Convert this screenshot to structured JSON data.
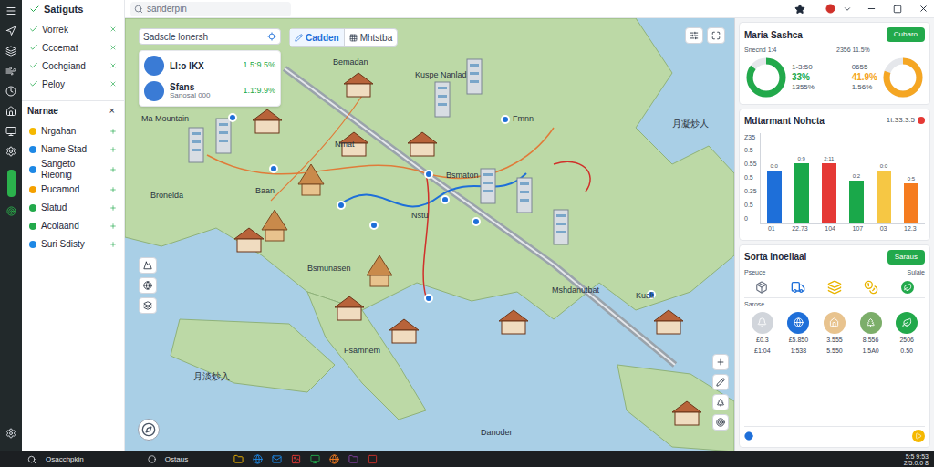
{
  "window": {
    "title": "Satiguts"
  },
  "search": {
    "placeholder": "sanderpin"
  },
  "sidebar": {
    "items": [
      {
        "label": "Vorrek"
      },
      {
        "label": "Cccemat"
      },
      {
        "label": "Cochgiand"
      },
      {
        "label": "Peloy"
      }
    ],
    "section": {
      "title": "Narnae",
      "close": "×",
      "items": [
        {
          "label": "Nrgahan",
          "color": "#f5b800"
        },
        {
          "label": "Name Stad",
          "color": "#1e88e5"
        },
        {
          "label": "Sangeto Rieonig",
          "color": "#1e88e5"
        },
        {
          "label": "Pucamod",
          "color": "#f5a000"
        },
        {
          "label": "Slatud",
          "color": "#22a94b"
        },
        {
          "label": "Acolaand",
          "color": "#22a94b"
        },
        {
          "label": "Suri Sdisty",
          "color": "#1e88e5"
        }
      ]
    }
  },
  "map": {
    "search": {
      "placeholder": "Sadscle lonersh"
    },
    "tabs": [
      {
        "label": "Cadden",
        "selected": true
      },
      {
        "label": "Mhtstba",
        "selected": false
      }
    ],
    "info_card": {
      "rows": [
        {
          "title": "Ll:o lKX",
          "subtitle": "",
          "value": "1.5:9.5%"
        },
        {
          "title": "Sfans",
          "subtitle": "Sanosal 000",
          "value": "1.1:9.9%"
        }
      ]
    },
    "labels": [
      "Bemadan",
      "Kuspe Nanlad",
      "Fmnn",
      "Nmat",
      "Bsmaton",
      "Bronelda",
      "Baan",
      "Nstu",
      "Bsmunasen",
      "Mshdanutbat",
      "Kuali",
      "Fsamnem",
      "Danoder",
      "Ma Mountain",
      "月淡炒入",
      "月凝炒人"
    ]
  },
  "summary": {
    "title": "Maria Sashca",
    "button": "Cubaro",
    "metrics": [
      {
        "top": "Snecnd 1:4",
        "sub": "1-3:50",
        "value": "33%",
        "bottom": "1355%",
        "level": 0.85,
        "color": "#22a94b"
      },
      {
        "top": "2356 11.5%",
        "sub": "0655",
        "value": "41.9%",
        "bottom": "1.56%",
        "level": 0.8,
        "color": "#f5a623"
      }
    ]
  },
  "chart": {
    "title": "Mdtarmant Nohcta",
    "badge": "1t.33.3.5",
    "ticks": [
      "Z35",
      "0.5",
      "0.55",
      "0.5",
      "0.35",
      "0.5",
      "0"
    ],
    "series": [
      {
        "values": [
          0.72,
          0.82,
          0.82,
          0.58,
          0.72,
          0.55
        ]
      }
    ],
    "bar_labels": [
      "0:0",
      "0:9",
      "2:11",
      "0:2",
      "0:0",
      "0:5"
    ],
    "x_labels": [
      "01",
      "22.73",
      "104",
      "107",
      "03",
      "12.3"
    ],
    "colors": [
      "#1e6fd9",
      "#1aa84a",
      "#e53935",
      "#1aa84a",
      "#f6c744",
      "#f57c1f"
    ]
  },
  "list": {
    "title": "Sorta Inoeliaal",
    "button": "Saraus",
    "left_header": "Pseuce",
    "right_header": "Sulaie",
    "section": "Sarose",
    "rows": [
      [
        "£0.3",
        "£5.850",
        "3.555",
        "8.556",
        "2506"
      ],
      [
        "£1:04",
        "1:538",
        "5.550",
        "1.5A0",
        "0.50"
      ]
    ]
  },
  "taskbar": {
    "search": "Osacchpkin",
    "app": "Ostaus",
    "time": "5:5 9:53",
    "date": "2/5:0:0 8"
  }
}
